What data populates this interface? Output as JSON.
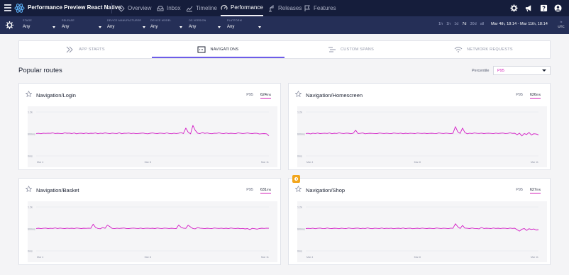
{
  "app": {
    "title": "Performance Preview React Native"
  },
  "nav": {
    "tabs": [
      {
        "label": "Overview",
        "icon": "overview-icon"
      },
      {
        "label": "Inbox",
        "icon": "inbox-icon"
      },
      {
        "label": "Timeline",
        "icon": "timeline-icon"
      },
      {
        "label": "Performance",
        "icon": "performance-icon",
        "active": true
      },
      {
        "label": "Releases",
        "icon": "releases-icon"
      },
      {
        "label": "Features",
        "icon": "features-icon"
      }
    ]
  },
  "filters": [
    {
      "label": "STAGE",
      "value": "Any"
    },
    {
      "label": "RELEASE",
      "value": "Any"
    },
    {
      "label": "DEVICE MANUFACTURER",
      "value": "Any"
    },
    {
      "label": "DEVICE MODEL",
      "value": "Any"
    },
    {
      "label": "OS VERSION",
      "value": "Any"
    },
    {
      "label": "PLATFORM",
      "value": "Any"
    }
  ],
  "time_ranges": [
    "1h",
    "1h",
    "1d",
    "7d",
    "30d",
    "all"
  ],
  "time_range_selected": "7d",
  "date_range": "Mar 4th, 18:14 - Mar 11th, 18:14",
  "timezone": {
    "top": "tz",
    "bottom": "UTC"
  },
  "subtabs": [
    {
      "label": "APP STARTS",
      "icon": "app-starts-icon"
    },
    {
      "label": "NAVIGATIONS",
      "icon": "navigations-icon",
      "active": true
    },
    {
      "label": "CUSTOM SPANS",
      "icon": "custom-spans-icon"
    },
    {
      "label": "NETWORK REQUESTS",
      "icon": "network-icon"
    }
  ],
  "section_title": "Popular routes",
  "percentile": {
    "label": "Percentile",
    "value": "P95"
  },
  "cards": [
    {
      "title": "Navigation/Login",
      "metric": "P95",
      "value": "624",
      "unit": "ms",
      "y_ticks": [
        "1.2k",
        "600ms",
        "0ms"
      ],
      "x_ticks": [
        "Mar 4",
        "Mar 8",
        "Mar 11"
      ],
      "series": [
        612,
        618,
        605,
        621,
        615,
        622,
        618,
        629,
        611,
        620,
        614,
        608,
        631,
        619,
        624,
        610,
        628,
        603,
        617,
        622,
        609,
        625,
        612,
        619,
        615,
        628,
        606,
        621,
        613,
        629,
        618,
        607,
        624,
        615,
        611,
        632,
        605,
        620,
        617,
        626,
        611,
        622,
        608,
        614,
        620,
        625,
        612,
        603,
        619,
        627,
        615,
        610,
        624,
        618,
        612,
        629,
        614,
        606,
        622,
        611,
        621,
        639,
        612,
        760,
        648,
        602,
        835,
        698,
        622,
        610,
        640,
        615,
        628,
        613,
        605,
        622,
        618,
        630,
        615,
        608,
        625,
        611,
        620,
        614,
        608,
        630,
        621,
        612,
        618,
        627,
        615,
        609,
        621,
        617,
        598,
        606,
        610,
        604,
        550
      ]
    },
    {
      "title": "Navigation/Homescreen",
      "metric": "P95",
      "value": "626",
      "unit": "ms",
      "y_ticks": [
        "1.2k",
        "600ms",
        "0ms"
      ],
      "x_ticks": [
        "Mar 4",
        "Mar 8",
        "Mar 11"
      ],
      "series": [
        611,
        618,
        602,
        621,
        612,
        625,
        609,
        616,
        622,
        614,
        628,
        606,
        620,
        613,
        630,
        617,
        611,
        624,
        619,
        605,
        621,
        700,
        612,
        618,
        628,
        604,
        614,
        620,
        615,
        612,
        609,
        625,
        618,
        611,
        622,
        614,
        608,
        626,
        617,
        613,
        624,
        605,
        619,
        612,
        621,
        615,
        610,
        626,
        618,
        613,
        622,
        609,
        616,
        620,
        614,
        611,
        628,
        617,
        612,
        623,
        615,
        607,
        620,
        800,
        660,
        615,
        760,
        640,
        604,
        622,
        611,
        628,
        617,
        613,
        624,
        610,
        618,
        622,
        615,
        608,
        624,
        614,
        619,
        625,
        611,
        616,
        630,
        616,
        619,
        578,
        622,
        545,
        612,
        584,
        642,
        570,
        605,
        598,
        575
      ]
    },
    {
      "title": "Navigation/Basket",
      "metric": "P95",
      "value": "631",
      "unit": "ms",
      "y_ticks": [
        "1.2k",
        "600ms",
        "0ms"
      ],
      "x_ticks": [
        "Mar 4",
        "Mar 8",
        "Mar 11"
      ],
      "series": [
        612,
        620,
        608,
        617,
        623,
        610,
        618,
        613,
        627,
        611,
        624,
        616,
        609,
        622,
        614,
        619,
        612,
        625,
        617,
        610,
        620,
        615,
        622,
        618,
        730,
        640,
        612,
        603,
        640,
        618,
        705,
        662,
        615,
        608,
        622,
        614,
        620,
        626,
        612,
        609,
        618,
        623,
        615,
        611,
        624,
        608,
        617,
        621,
        613,
        619,
        610,
        625,
        616,
        612,
        623,
        618,
        611,
        620,
        614,
        609,
        706,
        645,
        622,
        615,
        703,
        655,
        612,
        602,
        640,
        622,
        615,
        608,
        620,
        613,
        610,
        626,
        618,
        614,
        622,
        612,
        619,
        608,
        625,
        616,
        611,
        620,
        606,
        614,
        600,
        610,
        582,
        615,
        605,
        595,
        610,
        620,
        614,
        622,
        618
      ]
    },
    {
      "title": "Navigation/Shop",
      "metric": "P95",
      "value": "627",
      "unit": "ms",
      "y_ticks": [
        "1.2k",
        "600ms",
        "0ms"
      ],
      "x_ticks": [
        "Mar 4",
        "Mar 8",
        "Mar 11"
      ],
      "series": [
        609,
        616,
        611,
        621,
        605,
        618,
        624,
        612,
        608,
        626,
        614,
        610,
        620,
        616,
        606,
        622,
        613,
        609,
        625,
        615,
        611,
        619,
        623,
        607,
        617,
        612,
        628,
        614,
        606,
        621,
        616,
        611,
        625,
        609,
        618,
        613,
        622,
        606,
        615,
        620,
        612,
        626,
        608,
        617,
        621,
        605,
        614,
        619,
        611,
        624,
        616,
        610,
        620,
        613,
        607,
        625,
        618,
        611,
        621,
        615,
        608,
        622,
        617,
        742,
        660,
        612,
        695,
        623,
        618,
        609,
        626,
        614,
        612,
        602,
        640,
        611,
        620,
        616,
        609,
        625,
        613,
        619,
        611,
        622,
        617,
        608,
        624,
        614,
        620,
        578,
        540,
        592,
        612,
        560,
        605,
        585,
        598,
        570,
        580
      ]
    }
  ]
}
